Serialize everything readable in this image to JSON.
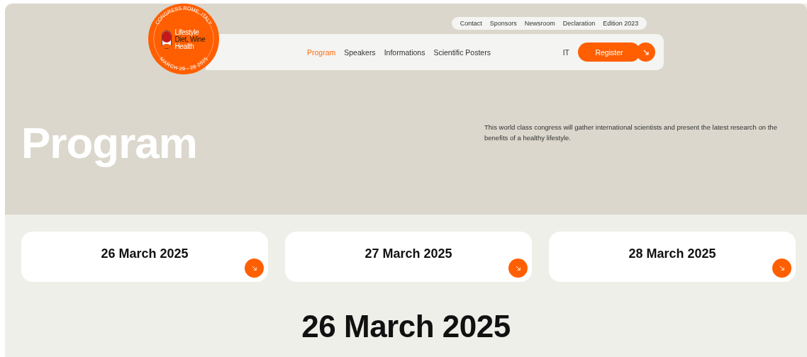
{
  "logo": {
    "lines": [
      "Lifestyle",
      "Diet, Wine",
      "Health"
    ],
    "top_ring": "CONGRESS ROME, ITALY",
    "bottom_ring": "MARCH 26 - 28 2025"
  },
  "top_links": [
    "Contact",
    "Sponsors",
    "Newsroom",
    "Declaration",
    "Edition 2023"
  ],
  "nav": [
    {
      "label": "Program",
      "selected": true
    },
    {
      "label": "Speakers",
      "selected": false
    },
    {
      "label": "Informations",
      "selected": false
    },
    {
      "label": "Scientific Posters",
      "selected": false
    }
  ],
  "language": "IT",
  "register_button": "Register",
  "hero": {
    "title": "Program",
    "description": "This world class congress will gather international scientists and present the latest research on the benefits of a healthy lifestyle."
  },
  "days": [
    "26 March 2025",
    "27 March 2025",
    "28 March 2025"
  ],
  "section_title": "26 March 2025"
}
